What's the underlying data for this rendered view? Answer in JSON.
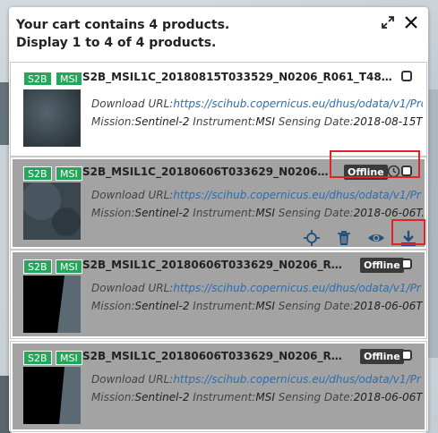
{
  "header": {
    "line1": "Your cart contains 4 products.",
    "line2": "Display 1 to 4 of 4 products."
  },
  "colors": {
    "tag_green": "#26a65b",
    "offline_badge": "#3a3a3a",
    "link_blue": "#2a6db3",
    "highlight_red": "#e0232b",
    "card_gray": "#a3a3a3"
  },
  "labels": {
    "download_url": "Download URL:",
    "mission": "Mission:",
    "instrument": "Instrument:",
    "sensing_date": "Sensing Date:"
  },
  "products": [
    {
      "tag1": "S2B",
      "tag2": "MSI",
      "title": "S2B_MSIL1C_20180815T033529_N0206_R061_T48RVV_2...",
      "status": "",
      "url": "https://scihub.copernicus.eu/dhus/odata/v1/Pro",
      "mission": "Sentinel-2",
      "instrument": "MSI",
      "sensing_date": "2018-08-15T0..."
    },
    {
      "tag1": "S2B",
      "tag2": "MSI",
      "title": "S2B_MSIL1C_20180606T033629_N0206_R...",
      "status": "Offline",
      "url": "https://scihub.copernicus.eu/dhus/odata/v1/Pr",
      "mission": "Sentinel-2",
      "instrument": "MSI",
      "sensing_date": "2018-06-06T..."
    },
    {
      "tag1": "S2B",
      "tag2": "MSI",
      "title": "S2B_MSIL1C_20180606T033629_N0206_R06...",
      "status": "Offline",
      "url": "https://scihub.copernicus.eu/dhus/odata/v1/Pr",
      "mission": "Sentinel-2",
      "instrument": "MSI",
      "sensing_date": "2018-06-06T0"
    },
    {
      "tag1": "S2B",
      "tag2": "MSI",
      "title": "S2B_MSIL1C_20180606T033629_N0206_R06...",
      "status": "Offline",
      "url": "https://scihub.copernicus.eu/dhus/odata/v1/Pr",
      "mission": "Sentinel-2",
      "instrument": "MSI",
      "sensing_date": "2018-06-06T0"
    }
  ],
  "icons": {
    "header": [
      "expand-icon",
      "close-icon"
    ],
    "row_status": [
      "clock-icon",
      "checkbox"
    ],
    "row_actions": [
      "locate-icon",
      "trash-icon",
      "eye-icon",
      "download-icon"
    ]
  }
}
